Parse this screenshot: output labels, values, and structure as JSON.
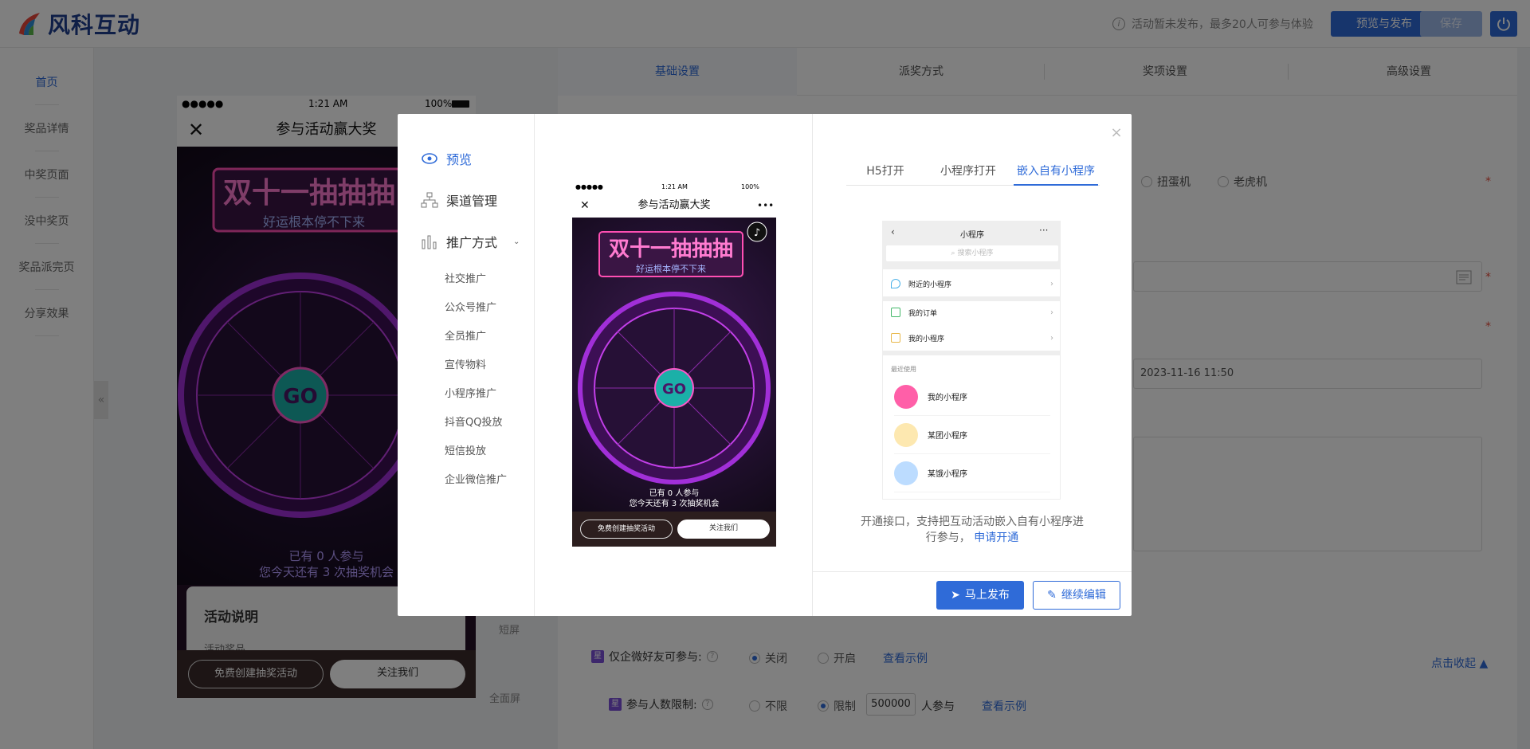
{
  "app": {
    "logo_text": "风科互动",
    "header_note": "活动暂未发布，最多20人可参与体验",
    "preview_publish": "预览与发布",
    "save": "保存"
  },
  "left_nav": {
    "items": [
      "首页",
      "奖品详情",
      "中奖页面",
      "没中奖页",
      "奖品派完页",
      "分享效果"
    ],
    "collapse": "«"
  },
  "preview_phone": {
    "carrier": "●●●●●",
    "time": "1:21 AM",
    "battery": "100%",
    "title": "参与活动赢大奖",
    "art_title": "双十一抽抽抽",
    "art_subtitle": "好运根本停不下来",
    "go_label": "GO",
    "joined": "已有 0 人参与",
    "remaining": "您今天还有 3 次抽奖机会",
    "desc_title": "活动说明",
    "desc_sub": "活动奖品",
    "btn_create": "免费创建抽奖活动",
    "btn_follow": "关注我们",
    "label_short": "短屏",
    "label_full": "全面屏"
  },
  "settings": {
    "tabs": [
      "基础设置",
      "派奖方式",
      "奖项设置",
      "高级设置"
    ],
    "game_options": [
      "扭蛋机",
      "老虎机"
    ],
    "date_value": "2023-11-16 11:50",
    "collapse_link": "点击收起",
    "rows": {
      "friends_only": {
        "label": "仅企微好友可参与:",
        "options": [
          "关闭",
          "开启"
        ],
        "link": "查看示例"
      },
      "limit": {
        "label": "参与人数限制:",
        "options": [
          "不限",
          "限制"
        ],
        "value": "500000",
        "unit": "人参与",
        "link": "查看示例"
      }
    }
  },
  "modal": {
    "nav": {
      "preview": "预览",
      "channel": "渠道管理",
      "promote": "推广方式",
      "subitems": [
        "社交推广",
        "公众号推广",
        "全员推广",
        "宣传物料",
        "小程序推广",
        "抖音QQ投放",
        "短信投放",
        "企业微信推广"
      ]
    },
    "tabs": [
      "H5打开",
      "小程序打开",
      "嵌入自有小程序"
    ],
    "mini_screen": {
      "title": "小程序",
      "search_placeholder": "搜索小程序",
      "rows": [
        "附近的小程序",
        "我的订单",
        "我的小程序"
      ],
      "recent_label": "最近使用",
      "apps": [
        "我的小程序",
        "某团小程序",
        "某饿小程序"
      ]
    },
    "desc_text": "开通接口，支持把互动活动嵌入自有小程序进行参与，",
    "desc_link": "申请开通",
    "btn_publish": "马上发布",
    "btn_edit": "继续编辑",
    "close": "×"
  }
}
